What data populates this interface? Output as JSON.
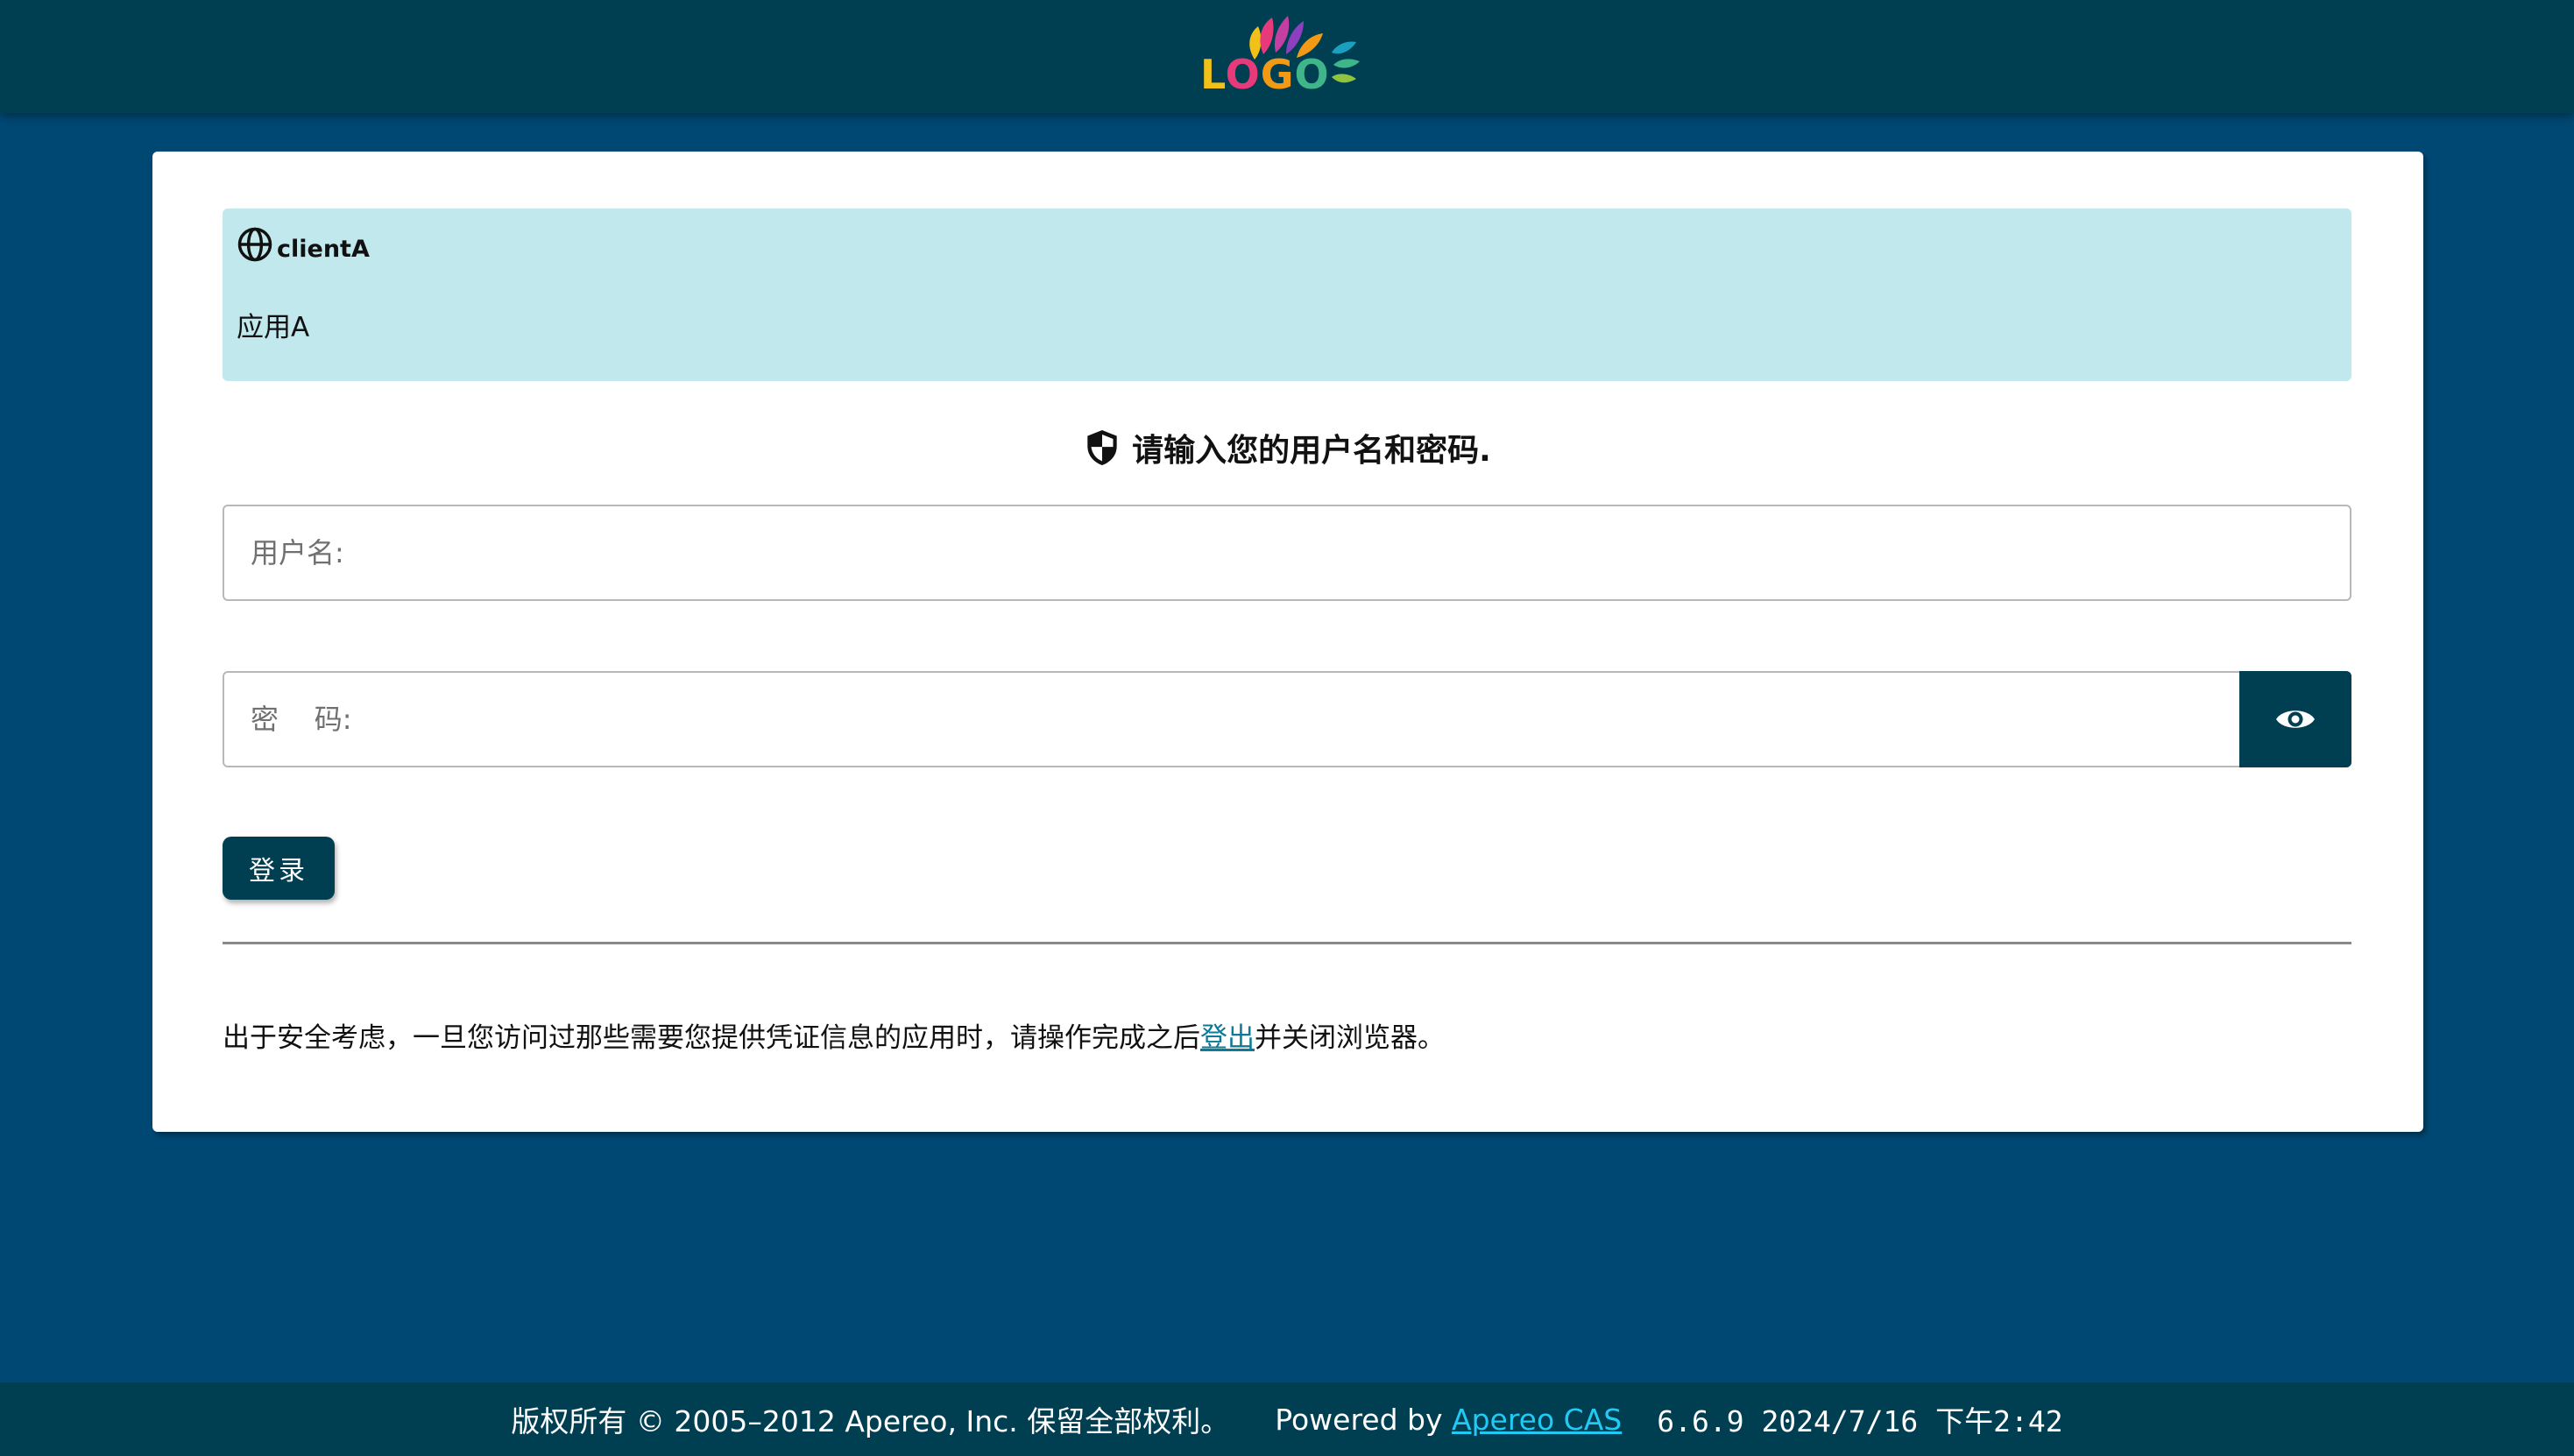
{
  "header": {
    "logo_text": [
      "L",
      "O",
      "G",
      "O"
    ],
    "logo_colors": [
      "#f2c117",
      "#e63a7a",
      "#f29a16",
      "#3fb58a"
    ]
  },
  "service": {
    "icon": "globe-icon",
    "name": "clientA",
    "description": "应用A"
  },
  "login": {
    "prompt_icon": "shield-icon",
    "prompt": "请输入您的用户名和密码.",
    "username_placeholder": "用户名:",
    "password_placeholder": "密    码:",
    "show_password_icon": "eye-icon",
    "submit_label": "登录"
  },
  "notice": {
    "before": "出于安全考虑，一旦您访问过那些需要您提供凭证信息的应用时，请操作完成之后",
    "link": "登出",
    "after": "并关闭浏览器。"
  },
  "footer": {
    "copyright": "版权所有 © 2005–2012 Apereo, Inc. 保留全部权利。",
    "powered_by": "Powered by ",
    "cas_link": "Apereo CAS",
    "version": "6.6.9 2024/7/16 下午2:42"
  },
  "colors": {
    "page_background": "#004874",
    "header_background": "#003e52",
    "service_box": "#c1e8ed",
    "primary_button": "#003e52",
    "link": "#0f7a97",
    "footer_link": "#21c9f5"
  }
}
